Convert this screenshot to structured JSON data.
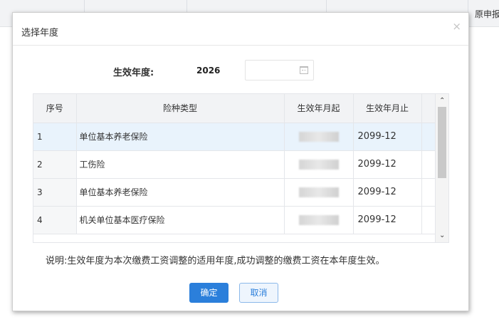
{
  "background": {
    "header_text": "原申报"
  },
  "dialog": {
    "title": "选择年度",
    "close_icon": "×",
    "year_label": "生效年度:",
    "year_value": "2026",
    "calendar_icon": "calendar-icon",
    "table": {
      "headers": [
        "序号",
        "险种类型",
        "生效年月起",
        "生效年月止"
      ],
      "rows": [
        {
          "index": "1",
          "type": "单位基本养老保险",
          "start": "",
          "end": "2099-12",
          "selected": true
        },
        {
          "index": "2",
          "type": "工伤险",
          "start": "",
          "end": "2099-12",
          "selected": false
        },
        {
          "index": "3",
          "type": "单位基本养老保险",
          "start": "",
          "end": "2099-12",
          "selected": false
        },
        {
          "index": "4",
          "type": "机关单位基本医疗保险",
          "start": "",
          "end": "2099-12",
          "selected": false
        }
      ],
      "scroll_up_icon": "⌃",
      "scroll_down_icon": "⌄"
    },
    "note": "说明:生效年度为本次缴费工资调整的适用年度,成功调整的缴费工资在本年度生效。",
    "ok_label": "确定",
    "cancel_label": "取消"
  },
  "colors": {
    "primary": "#2b7fdb",
    "selected_row": "#e9f3fc",
    "header_bg": "#f2f3f5"
  }
}
